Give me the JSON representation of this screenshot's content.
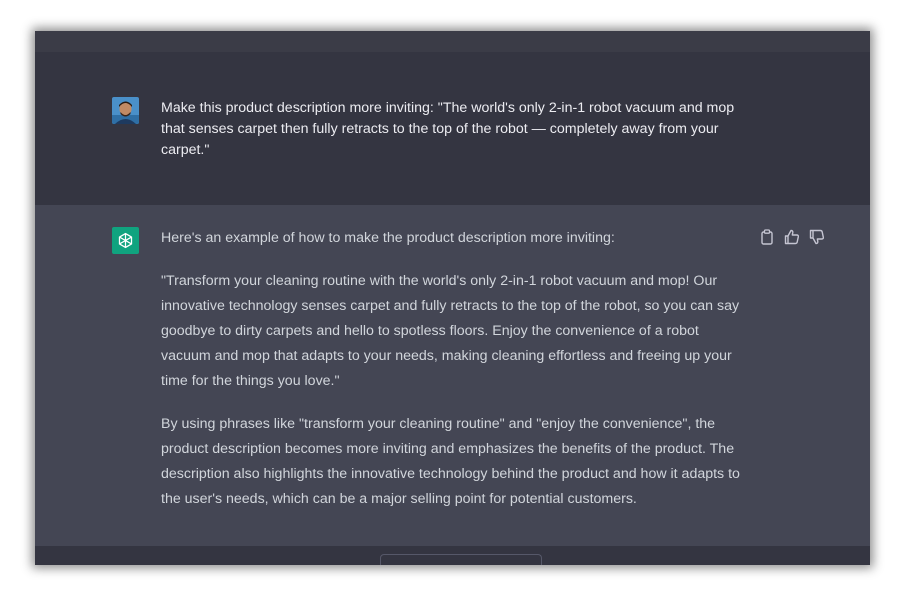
{
  "user_message": {
    "text": "Make this product description more inviting: \"The world's only 2-in-1 robot vacuum and mop that senses carpet then fully retracts to the top of the robot — completely away from your carpet.\""
  },
  "assistant_message": {
    "intro": "Here's an example of how to make the product description more inviting:",
    "quote": "\"Transform your cleaning routine with the world's only 2-in-1 robot vacuum and mop! Our innovative technology senses carpet and fully retracts to the top of the robot, so you can say goodbye to dirty carpets and hello to spotless floors. Enjoy the convenience of a robot vacuum and mop that adapts to your needs, making cleaning effortless and freeing up your time for the things you love.\"",
    "explanation": "By using phrases like \"transform your cleaning routine\" and \"enjoy the convenience\", the product description becomes more inviting and emphasizes the benefits of the product. The description also highlights the innovative technology behind the product and how it adapts to the user's needs, which can be a major selling point for potential customers."
  },
  "actions": {
    "copy_icon": "clipboard-icon",
    "like_icon": "thumbs-up-icon",
    "dislike_icon": "thumbs-down-icon"
  },
  "colors": {
    "user_bg": "#343541",
    "assistant_bg": "#444654",
    "accent": "#10a37f",
    "text": "#ececf1"
  }
}
